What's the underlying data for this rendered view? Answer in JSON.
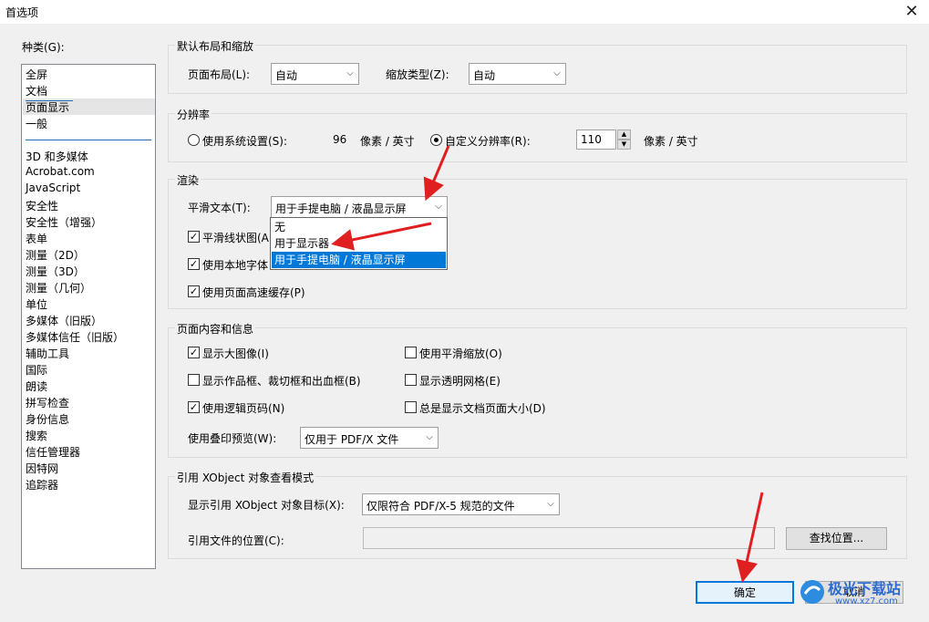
{
  "window": {
    "title": "首选项",
    "close_icon": "close-icon"
  },
  "categories": {
    "label": "种类(G):",
    "group1": [
      "全屏",
      "文档",
      "页面显示",
      "一般"
    ],
    "group2": [
      "3D 和多媒体",
      "Acrobat.com",
      "JavaScript",
      "安全性",
      "安全性（增强）",
      "表单",
      "测量（2D）",
      "测量（3D）",
      "测量（几何）",
      "单位",
      "多媒体（旧版）",
      "多媒体信任（旧版）",
      "辅助工具",
      "国际",
      "朗读",
      "拼写检查",
      "身份信息",
      "搜索",
      "信任管理器",
      "因特网",
      "追踪器"
    ],
    "selected": "页面显示"
  },
  "layout": {
    "title": "默认布局和缩放",
    "page_layout_label": "页面布局(L):",
    "page_layout_value": "自动",
    "zoom_type_label": "缩放类型(Z):",
    "zoom_type_value": "自动"
  },
  "resolution": {
    "title": "分辨率",
    "system_label": "使用系统设置(S):",
    "system_value": "96",
    "system_unit": "像素 / 英寸",
    "custom_label": "自定义分辨率(R):",
    "custom_value": "110",
    "custom_unit": "像素 / 英寸",
    "selected": "custom"
  },
  "render": {
    "title": "渲染",
    "smooth_text_label": "平滑文本(T):",
    "smooth_text_value": "用于手提电脑 / 液晶显示屏",
    "smooth_line": "平滑线状图(A",
    "local_font": "使用本地字体",
    "page_cache": "使用页面高速缓存(P)",
    "dropdown_options": [
      "无",
      "用于显示器",
      "用于手提电脑 / 液晶显示屏"
    ],
    "dropdown_selected_index": 2
  },
  "content": {
    "title": "页面内容和信息",
    "items": [
      {
        "label": "显示大图像(I)",
        "checked": true
      },
      {
        "label": "使用平滑缩放(O)",
        "checked": false
      },
      {
        "label": "显示作品框、裁切框和出血框(B)",
        "checked": false
      },
      {
        "label": "显示透明网格(E)",
        "checked": false
      },
      {
        "label": "使用逻辑页码(N)",
        "checked": true
      },
      {
        "label": "总是显示文档页面大小(D)",
        "checked": false
      }
    ],
    "overprint_label": "使用叠印预览(W):",
    "overprint_value": "仅用于 PDF/X 文件"
  },
  "xobject": {
    "title": "引用 XObject 对象查看模式",
    "target_label": "显示引用 XObject 对象目标(X):",
    "target_value": "仅限符合 PDF/X-5 规范的文件",
    "location_label": "引用文件的位置(C):",
    "location_value": "",
    "browse_label": "查找位置..."
  },
  "footer": {
    "ok_label": "确定",
    "cancel_label": "取消"
  },
  "watermark": {
    "text": "极光下载站",
    "url": "www.xz7.com"
  },
  "colors": {
    "selection": "#0078d7",
    "arrow": "#e02020",
    "separator": "#1e6fb8"
  }
}
